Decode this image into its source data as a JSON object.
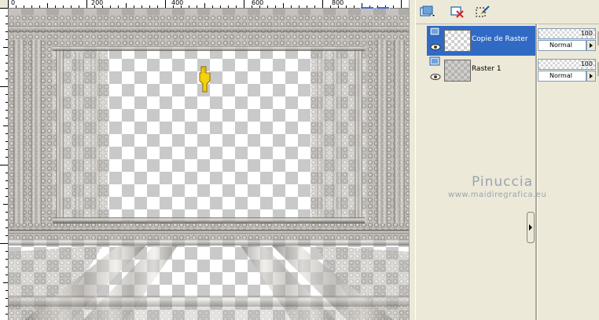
{
  "ruler": {
    "labels": [
      "0",
      "200",
      "400",
      "600",
      "800"
    ]
  },
  "layers": [
    {
      "name": "Copie de Raster",
      "opacity": "100",
      "blend_mode": "Normal",
      "selected": true
    },
    {
      "name": "Raster 1",
      "opacity": "100",
      "blend_mode": "Normal",
      "selected": false
    }
  ],
  "watermark": {
    "title": "Pinuccia",
    "url": "www.maidiregrafica.eu"
  },
  "toolbar": {
    "icons": [
      "new-layer-icon",
      "delete-layer-icon",
      "edit-selection-icon"
    ]
  },
  "colors": {
    "selection": "#316ac5",
    "panel": "#ece9d8",
    "watermark": "#8c98a8"
  }
}
